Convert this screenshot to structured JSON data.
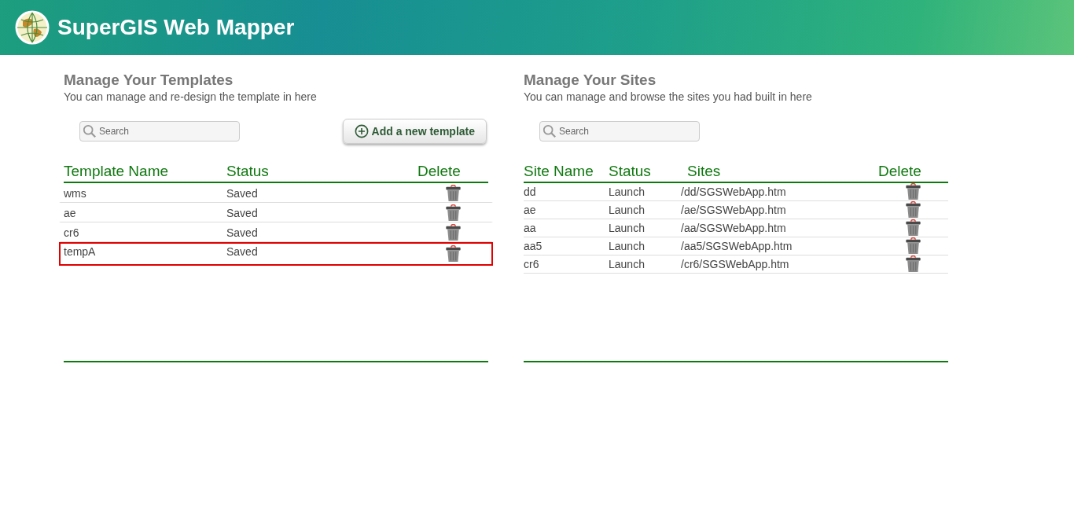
{
  "header": {
    "title": "SuperGIS Web Mapper"
  },
  "templates": {
    "title": "Manage Your Templates",
    "subtitle": "You can manage and re-design the template in here",
    "search": {
      "placeholder": "Search"
    },
    "add_button": "Add a new template",
    "columns": [
      "Template Name",
      "Status",
      "Delete"
    ],
    "rows": [
      {
        "name": "wms",
        "status": "Saved",
        "selected": false
      },
      {
        "name": "ae",
        "status": "Saved",
        "selected": false
      },
      {
        "name": "cr6",
        "status": "Saved",
        "selected": false
      },
      {
        "name": "tempA",
        "status": "Saved",
        "selected": true
      }
    ]
  },
  "sites": {
    "title": "Manage Your Sites",
    "subtitle": "You can manage and browse the sites you had built in here",
    "search": {
      "placeholder": "Search"
    },
    "columns": [
      "Site Name",
      "Status",
      "Sites",
      "Delete"
    ],
    "rows": [
      {
        "name": "dd",
        "status": "Launch",
        "path": "/dd/SGSWebApp.htm"
      },
      {
        "name": "ae",
        "status": "Launch",
        "path": "/ae/SGSWebApp.htm"
      },
      {
        "name": "aa",
        "status": "Launch",
        "path": "/aa/SGSWebApp.htm"
      },
      {
        "name": "aa5",
        "status": "Launch",
        "path": "/aa5/SGSWebApp.htm"
      },
      {
        "name": "cr6",
        "status": "Launch",
        "path": "/cr6/SGSWebApp.htm"
      }
    ]
  }
}
